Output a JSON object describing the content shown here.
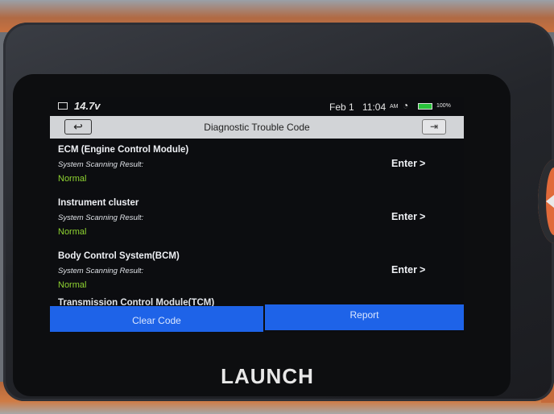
{
  "device": {
    "brand": "LAUNCH"
  },
  "statusbar": {
    "voltage": "14.7v",
    "date": "Feb 1",
    "time": "11:04",
    "ampm": "AM",
    "battery_percent": "100%",
    "battery_color": "#29c23a"
  },
  "titlebar": {
    "title": "Diagnostic Trouble Code",
    "back_icon": "back-arrow-icon",
    "exit_icon": "exit-icon"
  },
  "systems": [
    {
      "name": "ECM (Engine Control Module)",
      "result_label": "System Scanning Result:",
      "result": "Normal",
      "enter_label": "Enter"
    },
    {
      "name": "Instrument cluster",
      "result_label": "System Scanning Result:",
      "result": "Normal",
      "enter_label": "Enter"
    },
    {
      "name": "Body Control System(BCM)",
      "result_label": "System Scanning Result:",
      "result": "Normal",
      "enter_label": "Enter"
    },
    {
      "name": "Transmission Control Module(TCM)"
    }
  ],
  "actions": {
    "clear_code": "Clear Code",
    "report": "Report",
    "accent_color": "#1e63e8"
  },
  "colors": {
    "status_normal": "#8fd431"
  }
}
